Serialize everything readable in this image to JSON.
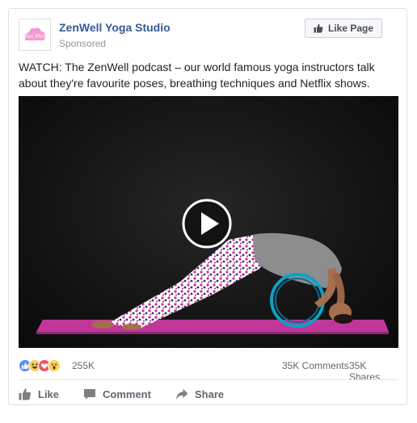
{
  "post": {
    "page_name": "ZenWell Yoga Studio",
    "sponsored_label": "Sponsored",
    "logo_text": "Zen Well",
    "like_page_label": "Like Page",
    "text": "WATCH: The ZenWell podcast – our world famous yoga instructors talk about they're favourite poses, breathing techniques and Netflix shows."
  },
  "video": {
    "icon": "play-icon"
  },
  "stats": {
    "reactions": [
      "like",
      "haha",
      "love",
      "wow"
    ],
    "reaction_count": "255K",
    "comments": "35K Comments",
    "shares": "35K Shares"
  },
  "actions": {
    "like_label": "Like",
    "comment_label": "Comment",
    "share_label": "Share"
  },
  "colors": {
    "link_blue": "#365899",
    "secondary_text": "#90949c",
    "like_blue": "#5890ff",
    "love_red": "#f25268",
    "haha_yellow": "#fcd05c",
    "mat_magenta": "#c0369b",
    "brand_pink": "#f39ad3"
  }
}
